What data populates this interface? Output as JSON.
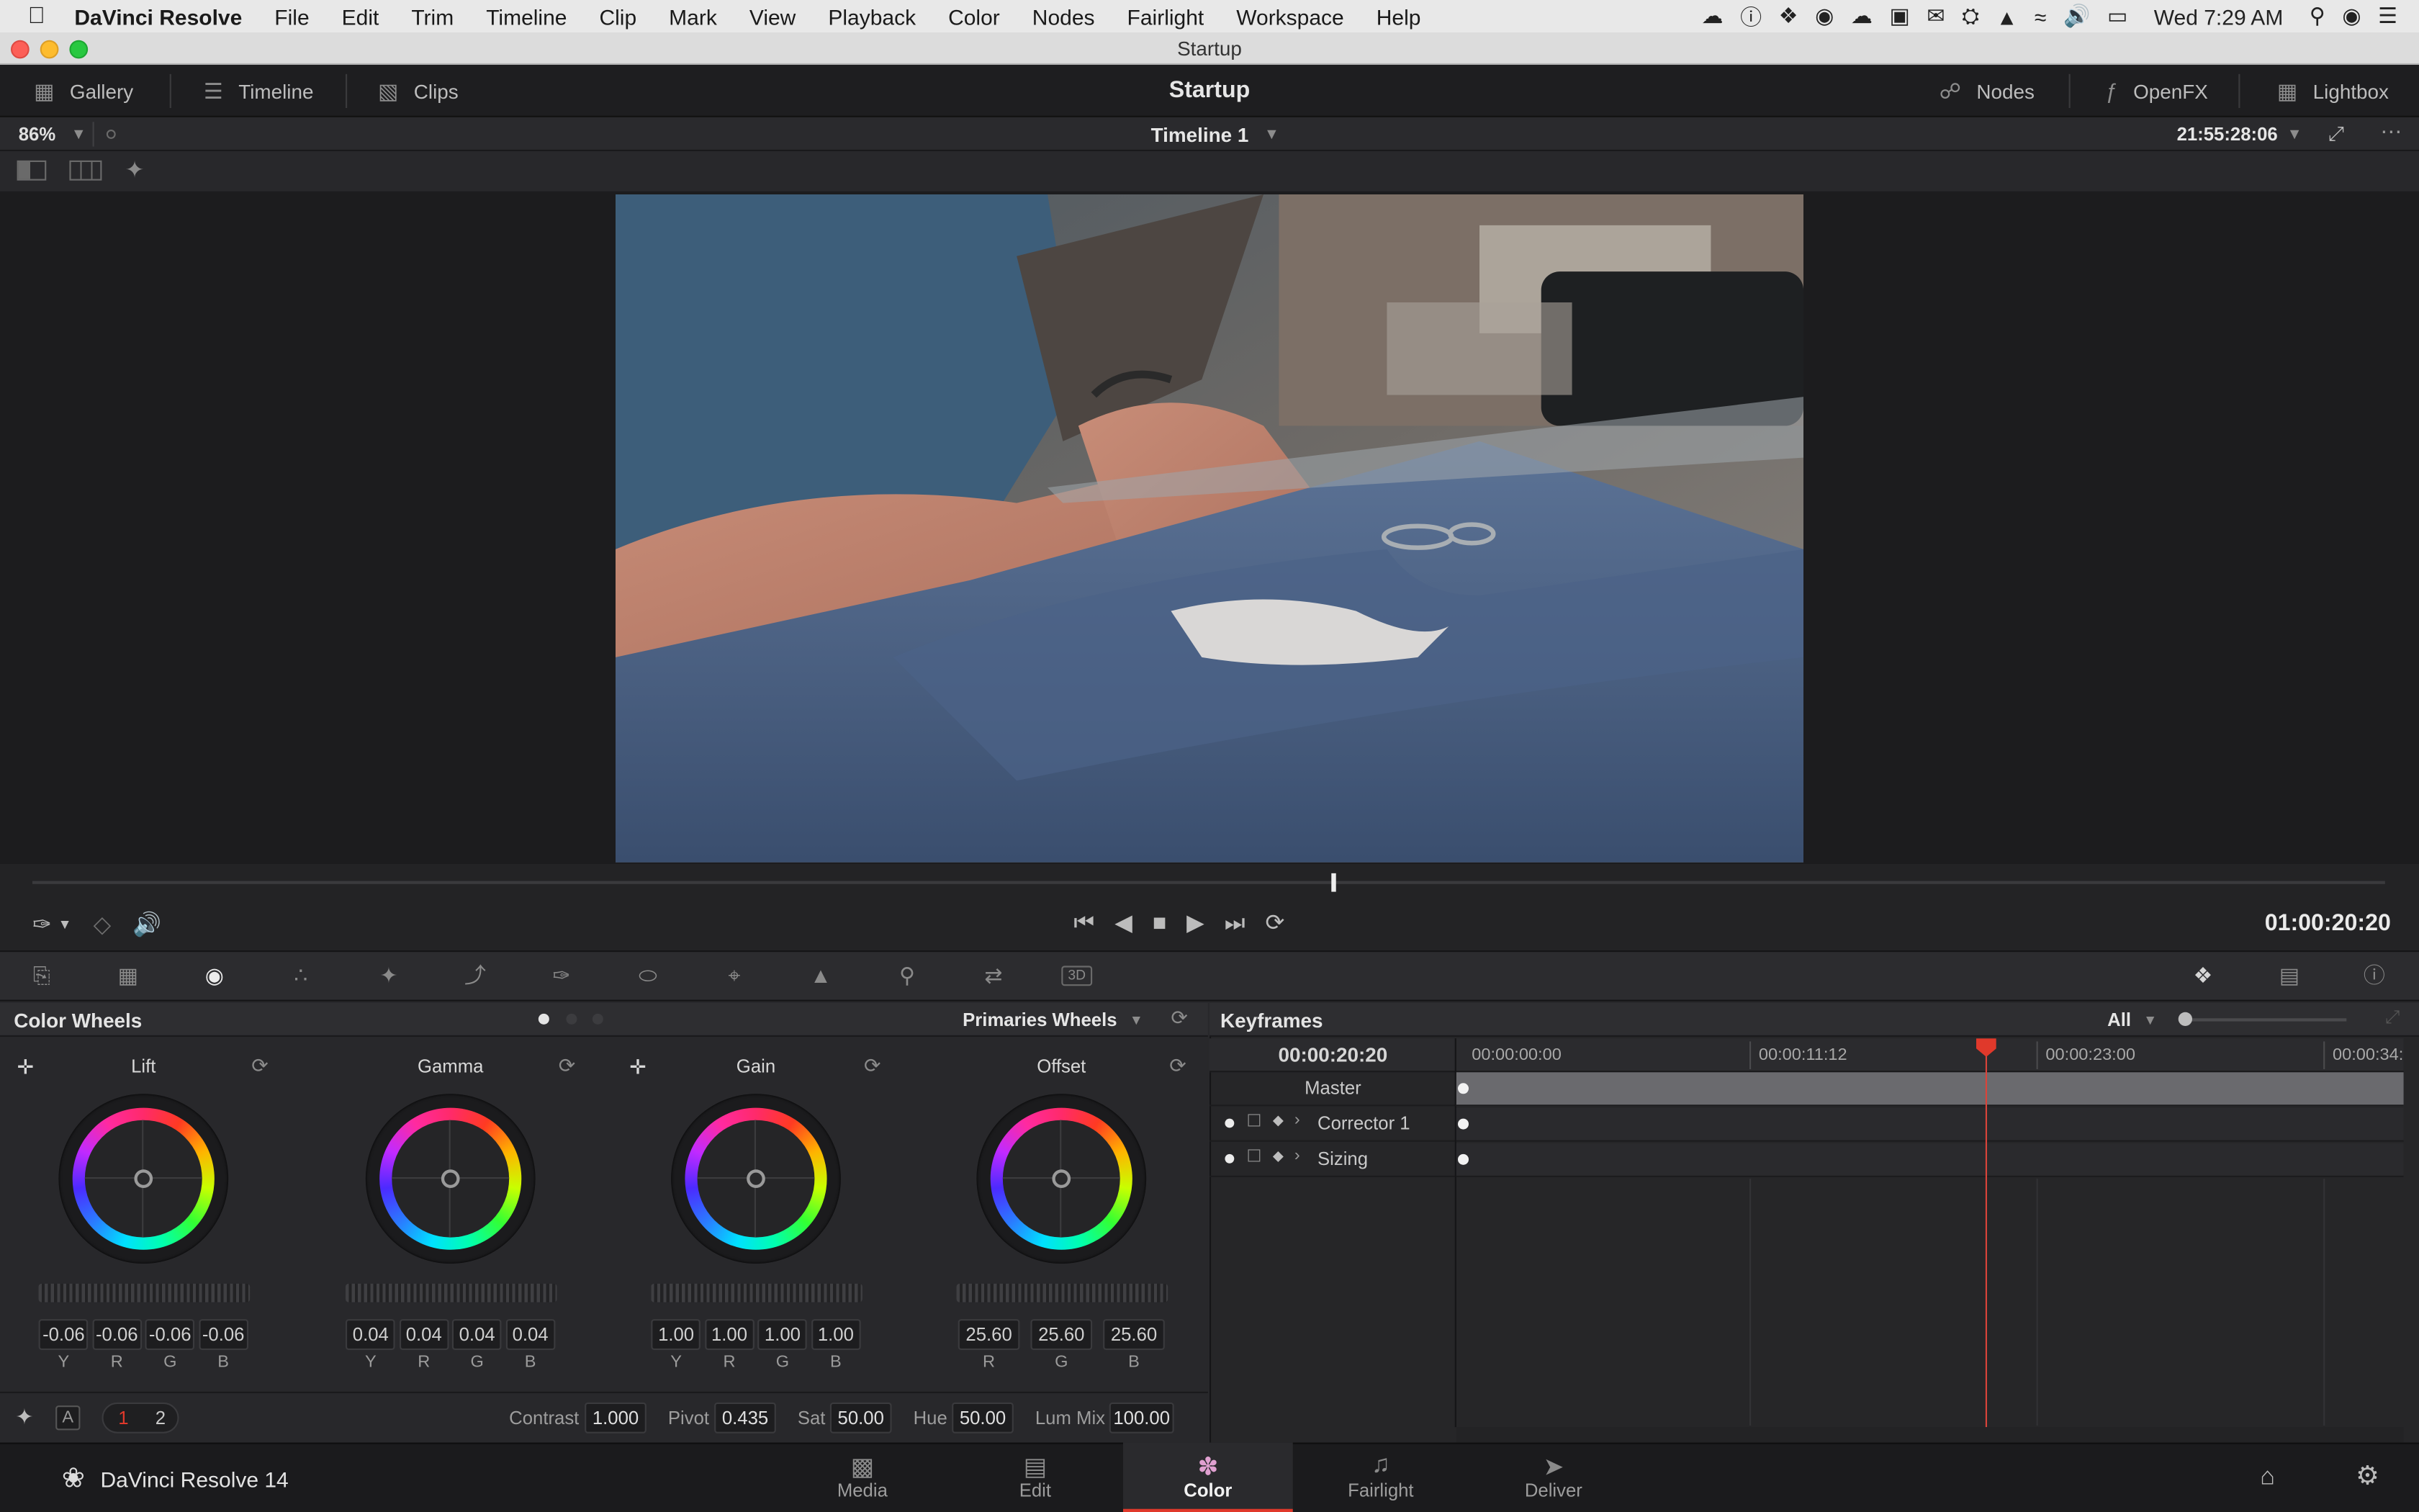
{
  "menubar": {
    "app_name": "DaVinci Resolve",
    "items": [
      "File",
      "Edit",
      "Trim",
      "Timeline",
      "Clip",
      "Mark",
      "View",
      "Playback",
      "Color",
      "Nodes",
      "Fairlight",
      "Workspace",
      "Help"
    ],
    "clock": "Wed 7:29 AM"
  },
  "window": {
    "title": "Startup"
  },
  "header": {
    "gallery": "Gallery",
    "timeline": "Timeline",
    "clips": "Clips",
    "project": "Startup",
    "nodes": "Nodes",
    "openfx": "OpenFX",
    "lightbox": "Lightbox"
  },
  "viewer": {
    "zoom": "86%",
    "timeline_name": "Timeline 1",
    "source_tc": "21:55:28:06",
    "playhead_tc": "01:00:20:20",
    "playhead_fraction": 0.553
  },
  "color_wheels": {
    "title": "Color Wheels",
    "mode": "Primaries Wheels",
    "wheels": [
      {
        "name": "Lift",
        "labels": [
          "Y",
          "R",
          "G",
          "B"
        ],
        "values": [
          "-0.06",
          "-0.06",
          "-0.06",
          "-0.06"
        ]
      },
      {
        "name": "Gamma",
        "labels": [
          "Y",
          "R",
          "G",
          "B"
        ],
        "values": [
          "0.04",
          "0.04",
          "0.04",
          "0.04"
        ]
      },
      {
        "name": "Gain",
        "labels": [
          "Y",
          "R",
          "G",
          "B"
        ],
        "values": [
          "1.00",
          "1.00",
          "1.00",
          "1.00"
        ]
      },
      {
        "name": "Offset",
        "labels": [
          "R",
          "G",
          "B"
        ],
        "values": [
          "25.60",
          "25.60",
          "25.60"
        ]
      }
    ],
    "footer": {
      "page1": "1",
      "page2": "2",
      "auto": "A",
      "contrast_label": "Contrast",
      "contrast": "1.000",
      "pivot_label": "Pivot",
      "pivot": "0.435",
      "sat_label": "Sat",
      "sat": "50.00",
      "hue_label": "Hue",
      "hue": "50.00",
      "lummix_label": "Lum Mix",
      "lummix": "100.00"
    }
  },
  "keyframes": {
    "title": "Keyframes",
    "filter": "All",
    "current_tc": "00:00:20:20",
    "ruler": [
      "00:00:00:00",
      "00:00:11:12",
      "00:00:23:00",
      "00:00:34:"
    ],
    "tracks": [
      "Master",
      "Corrector 1",
      "Sizing"
    ]
  },
  "pages": {
    "app_label": "DaVinci Resolve 14",
    "items": [
      "Media",
      "Edit",
      "Color",
      "Fairlight",
      "Deliver"
    ],
    "active": "Color"
  },
  "colors": {
    "accent_red": "#e0392b",
    "playhead": "#d9433a"
  }
}
